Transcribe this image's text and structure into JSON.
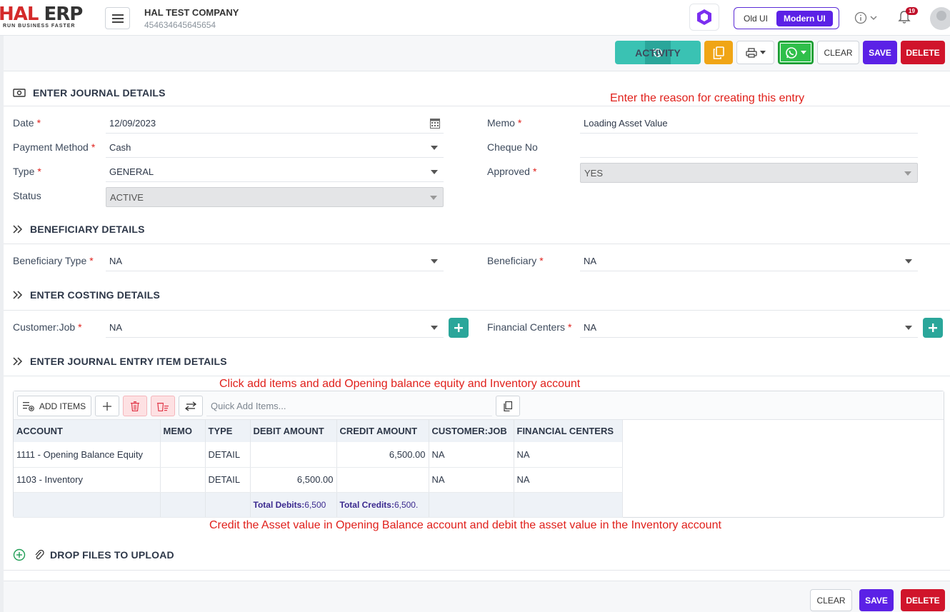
{
  "header": {
    "logo_main": "HAL ERP",
    "logo_tagline": "RUN BUSINESS FASTER",
    "company_name": "HAL TEST COMPANY",
    "company_id": "454634645645654",
    "ui_old": "Old UI",
    "ui_modern": "Modern UI",
    "notification_count": "19"
  },
  "actions": {
    "activity": "ACTIVITY",
    "clear": "CLEAR",
    "save": "SAVE",
    "delete": "DELETE"
  },
  "sections": {
    "journal": "ENTER JOURNAL DETAILS",
    "beneficiary": "BENEFICIARY DETAILS",
    "costing": "ENTER COSTING DETAILS",
    "items": "ENTER JOURNAL ENTRY ITEM DETAILS",
    "files": "DROP FILES TO UPLOAD"
  },
  "annotations": {
    "memo_hint": "Enter the reason for creating this entry",
    "items_hint": "Click add items and add Opening balance equity and Inventory account",
    "credit_hint": "Credit the Asset value in Opening Balance account and debit the asset value in the Inventory account"
  },
  "journal": {
    "date_label": "Date",
    "date_value": "12/09/2023",
    "payment_label": "Payment Method",
    "payment_value": "Cash",
    "type_label": "Type",
    "type_value": "GENERAL",
    "status_label": "Status",
    "status_value": "ACTIVE",
    "memo_label": "Memo",
    "memo_value": "Loading Asset Value",
    "cheque_label": "Cheque No",
    "cheque_value": "",
    "approved_label": "Approved",
    "approved_value": "YES"
  },
  "beneficiary": {
    "type_label": "Beneficiary Type",
    "type_value": "NA",
    "ben_label": "Beneficiary",
    "ben_value": "NA"
  },
  "costing": {
    "job_label": "Customer:Job",
    "job_value": "NA",
    "fc_label": "Financial Centers",
    "fc_value": "NA"
  },
  "items_toolbar": {
    "add_items": "ADD ITEMS",
    "quick_placeholder": "Quick Add Items..."
  },
  "items_table": {
    "columns": [
      "ACCOUNT",
      "MEMO",
      "TYPE",
      "DEBIT AMOUNT",
      "CREDIT AMOUNT",
      "CUSTOMER:JOB",
      "FINANCIAL CENTERS"
    ],
    "rows": [
      {
        "account": "1111 - Opening Balance Equity",
        "memo": "",
        "type": "DETAIL",
        "debit": "",
        "credit": "6,500.00",
        "job": "NA",
        "fc": "NA"
      },
      {
        "account": "1103 - Inventory",
        "memo": "",
        "type": "DETAIL",
        "debit": "6,500.00",
        "credit": "",
        "job": "NA",
        "fc": "NA"
      }
    ],
    "total_debits_label": "Total Debits:",
    "total_debits_value": "6,500",
    "total_credits_label": "Total Credits:",
    "total_credits_value": "6,500."
  }
}
